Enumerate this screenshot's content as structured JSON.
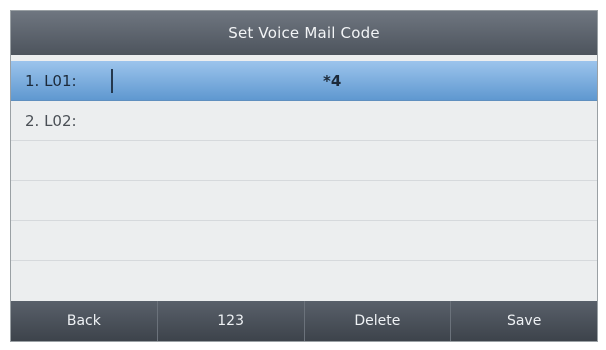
{
  "screen": {
    "title": "Set Voice Mail Code"
  },
  "fields": [
    {
      "label": "1. L01:",
      "value": "*4",
      "selected": true
    },
    {
      "label": "2. L02:",
      "value": "",
      "selected": false
    }
  ],
  "softkeys": [
    "Back",
    "123",
    "Delete",
    "Save"
  ],
  "colors": {
    "selection": "#5f98d0",
    "titlebar": "#4d545d",
    "background": "#eceeef"
  }
}
